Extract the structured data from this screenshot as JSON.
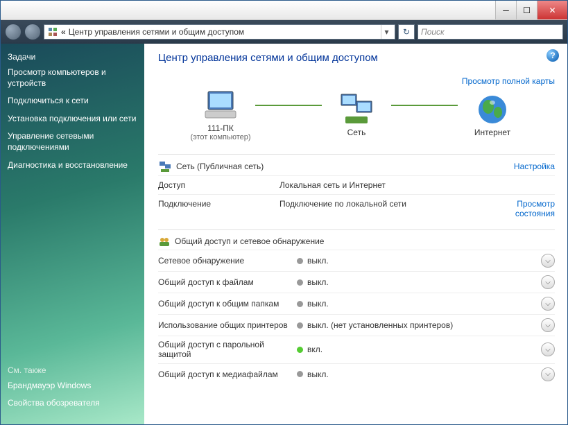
{
  "titlebar": {
    "minimize": "─",
    "maximize": "☐",
    "close": "✕"
  },
  "navbar": {
    "breadcrumb_prefix": "«",
    "breadcrumb": "Центр управления сетями и общим доступом",
    "dropdown": "▾",
    "refresh": "↻",
    "search_placeholder": "Поиск"
  },
  "sidebar": {
    "tasks_header": "Задачи",
    "items": [
      "Просмотр компьютеров и устройств",
      "Подключиться к сети",
      "Установка подключения или сети",
      "Управление сетевыми подключениями",
      "Диагностика и восстановление"
    ],
    "see_also_header": "См. также",
    "see_also": [
      "Брандмауэр Windows",
      "Свойства обозревателя"
    ]
  },
  "content": {
    "title": "Центр управления сетями и общим доступом",
    "view_full_map": "Просмотр полной карты",
    "help": "?",
    "diagram": {
      "pc_name": "111-ПК",
      "pc_sub": "(этот компьютер)",
      "network": "Сеть",
      "internet": "Интернет"
    },
    "network_section": {
      "title": "Сеть (Публичная сеть)",
      "configure": "Настройка",
      "rows": [
        {
          "label": "Доступ",
          "value": "Локальная сеть и Интернет",
          "action": ""
        },
        {
          "label": "Подключение",
          "value": "Подключение по локальной сети",
          "action": "Просмотр состояния"
        }
      ]
    },
    "sharing_section": {
      "title": "Общий доступ и сетевое обнаружение",
      "rows": [
        {
          "label": "Сетевое обнаружение",
          "status": "выкл.",
          "on": false
        },
        {
          "label": "Общий доступ к файлам",
          "status": "выкл.",
          "on": false
        },
        {
          "label": "Общий доступ к общим папкам",
          "status": "выкл.",
          "on": false
        },
        {
          "label": "Использование общих принтеров",
          "status": "выкл. (нет установленных принтеров)",
          "on": false
        },
        {
          "label": "Общий доступ с парольной защитой",
          "status": "вкл.",
          "on": true
        },
        {
          "label": "Общий доступ к медиафайлам",
          "status": "выкл.",
          "on": false
        }
      ]
    },
    "chevron": "⌵"
  }
}
